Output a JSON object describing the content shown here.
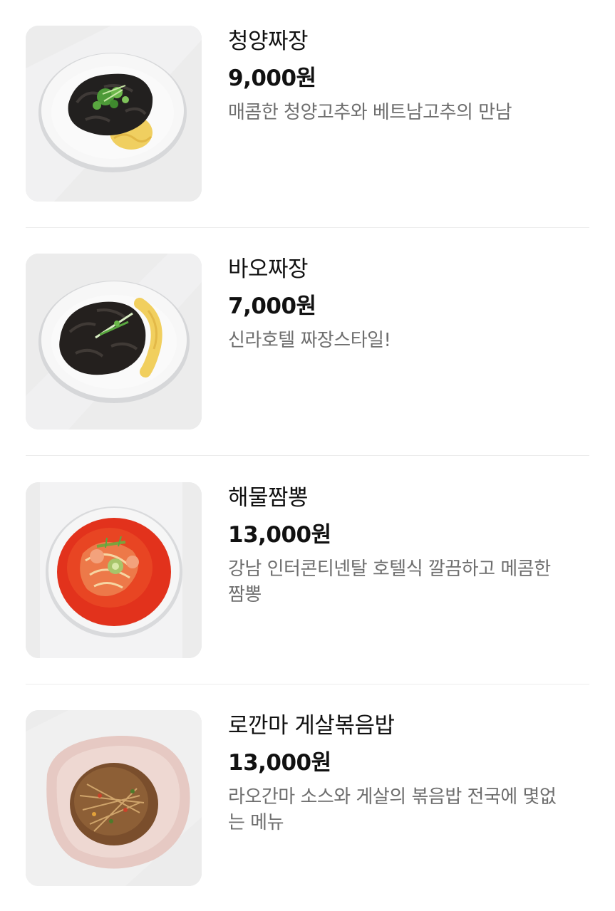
{
  "menu": {
    "items": [
      {
        "name": "청양짜장",
        "price": "9,000원",
        "description": "매콤한 청양고추와 베트남고추의 만남"
      },
      {
        "name": "바오짜장",
        "price": "7,000원",
        "description": "신라호텔 짜장스타일!"
      },
      {
        "name": "해물짬뽕",
        "price": "13,000원",
        "description": "강남 인터콘티넨탈 호텔식 깔끔하고 메콤한 짬뽕"
      },
      {
        "name": "로깐마 게살볶음밥",
        "price": "13,000원",
        "description": "라오간마 소스와 게살의 볶음밥  전국에 몇없는 메뉴"
      }
    ]
  },
  "colors": {
    "text_primary": "#111111",
    "text_secondary": "#6e6e6e",
    "divider": "#ececec",
    "background": "#ffffff"
  }
}
